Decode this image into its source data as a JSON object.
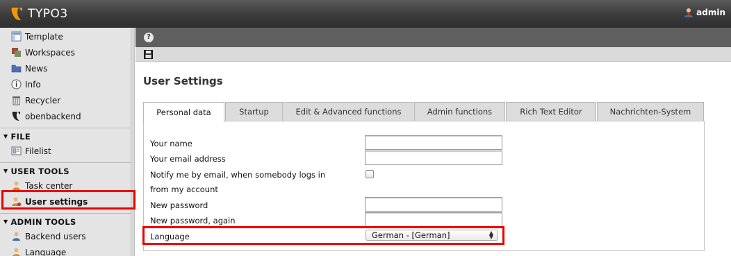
{
  "app": {
    "name": "TYPO3",
    "user": "admin"
  },
  "sidebar": {
    "items_top": [
      {
        "label": "Template",
        "icon": "template-icon"
      },
      {
        "label": "Workspaces",
        "icon": "workspaces-icon"
      },
      {
        "label": "News",
        "icon": "folder-icon"
      },
      {
        "label": "Info",
        "icon": "info-icon"
      },
      {
        "label": "Recycler",
        "icon": "trash-icon"
      },
      {
        "label": "obenbackend",
        "icon": "typo3-icon"
      }
    ],
    "file_header": "FILE",
    "file_items": [
      {
        "label": "Filelist",
        "icon": "filelist-icon"
      }
    ],
    "user_tools_header": "USER TOOLS",
    "user_tools_items": [
      {
        "label": "Task center",
        "icon": "task-center-icon"
      },
      {
        "label": "User settings",
        "icon": "user-settings-icon",
        "active": true
      }
    ],
    "admin_tools_header": "ADMIN TOOLS",
    "admin_tools_items": [
      {
        "label": "Backend users",
        "icon": "backend-users-icon"
      },
      {
        "label": "Language",
        "icon": "language-icon"
      }
    ]
  },
  "toolbar": {
    "help_label": "?",
    "save_icon": "save-icon"
  },
  "main": {
    "title": "User Settings",
    "tabs": [
      {
        "label": "Personal data",
        "active": true
      },
      {
        "label": "Startup"
      },
      {
        "label": "Edit & Advanced functions"
      },
      {
        "label": "Admin functions"
      },
      {
        "label": "Rich Text Editor"
      },
      {
        "label": "Nachrichten-System"
      }
    ],
    "form": {
      "your_name_label": "Your name",
      "your_name_value": "",
      "email_label": "Your email address",
      "email_value": "",
      "notify_label_line1": "Notify me by email, when somebody logs in",
      "notify_label_line2": "from my account",
      "notify_checked": false,
      "new_password_label": "New password",
      "new_password_again_label": "New password, again",
      "language_label": "Language",
      "language_value": "German - [German]"
    }
  },
  "colors": {
    "highlight": "#e00000",
    "topbar": "#3a3a3a",
    "typo3_orange": "#f49700"
  }
}
